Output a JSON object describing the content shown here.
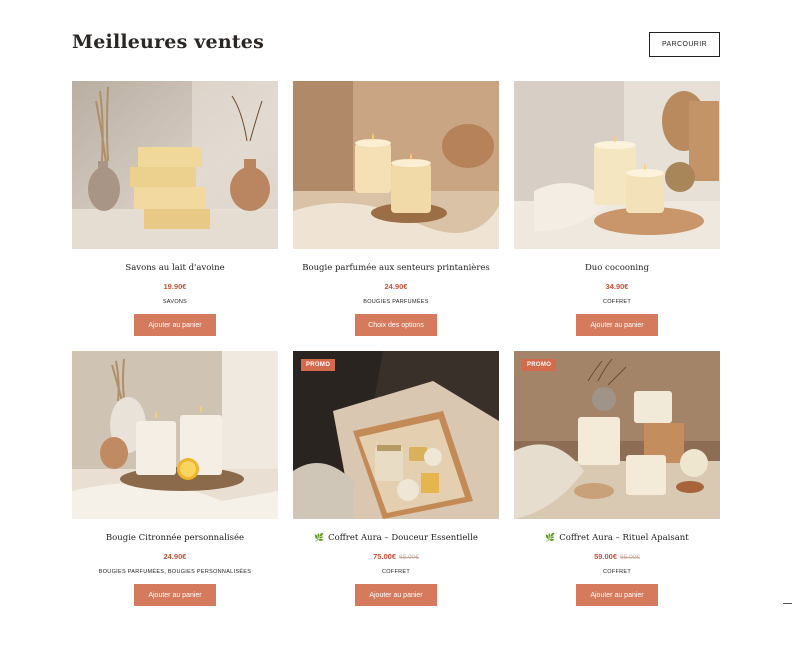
{
  "header": {
    "title": "Meilleures ventes",
    "browse_label": "PARCOURIR"
  },
  "products": [
    {
      "name": "Savons au lait d'avoine",
      "price": "19.90€",
      "old_price": "",
      "category": "SAVONS",
      "button": "Ajouter au panier",
      "badge": ""
    },
    {
      "name": "Bougie parfumée aux senteurs printanières",
      "price": "24.90€",
      "old_price": "",
      "category": "BOUGIES PARFUMÉES",
      "button": "Choix des options",
      "badge": ""
    },
    {
      "name": "Duo cocooning",
      "price": "34.90€",
      "old_price": "",
      "category": "COFFRET",
      "button": "Ajouter au panier",
      "badge": ""
    },
    {
      "name": "Bougie Citronnée personnalisée",
      "price": "24.90€",
      "old_price": "",
      "category": "BOUGIES PARFUMÉES, BOUGIES PERSONNALISÉES",
      "button": "Ajouter au panier",
      "badge": ""
    },
    {
      "name": "Coffret Aura – Douceur Essentielle",
      "price": "75.00€",
      "old_price": "85.00€",
      "category": "COFFRET",
      "button": "Ajouter au panier",
      "badge": "PROMO",
      "leaf": "🌿"
    },
    {
      "name": "Coffret Aura – Rituel Apaisant",
      "price": "59.00€",
      "old_price": "65.00€",
      "category": "COFFRET",
      "button": "Ajouter au panier",
      "badge": "PROMO",
      "leaf": "🌿"
    }
  ]
}
